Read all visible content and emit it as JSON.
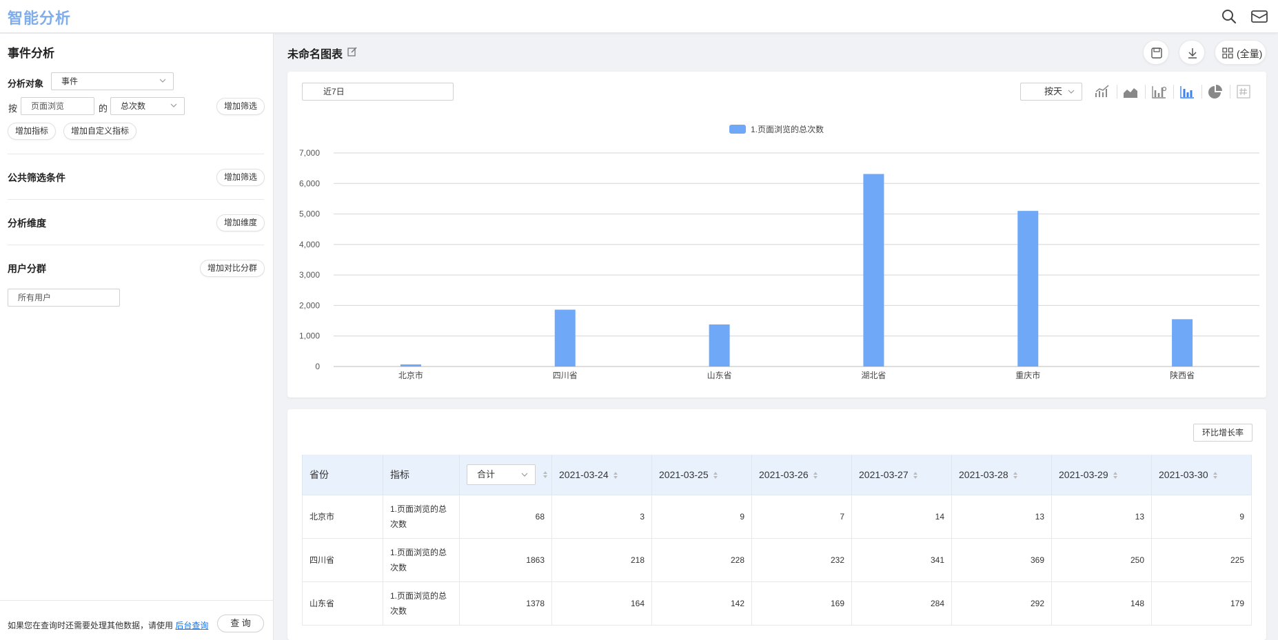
{
  "app": {
    "brand": "智能分析"
  },
  "header": {
    "icons": [
      "search-icon",
      "mail-icon"
    ]
  },
  "left": {
    "title": "事件分析",
    "analysis_target_label": "分析对象",
    "analysis_target_value": "事件",
    "by_label": "按",
    "event_value": "页面浏览",
    "of_label": "的",
    "metric_value": "总次数",
    "add_filter": "增加筛选",
    "add_metric": "增加指标",
    "add_custom_metric": "增加自定义指标",
    "public_filter_title": "公共筛选条件",
    "public_add_filter": "增加筛选",
    "dimension_title": "分析维度",
    "add_dimension": "增加维度",
    "segment_title": "用户分群",
    "add_segment": "增加对比分群",
    "segment_value": "所有用户",
    "footer_note": "如果您在查询时还需要处理其他数据，请使用",
    "footer_link": "后台查询",
    "query_button": "查 询"
  },
  "main": {
    "chart_title": "未命名图表",
    "fullscreen_label": "(全量)",
    "date_range": "近7日",
    "granularity": "按天",
    "ratio_button": "环比增长率"
  },
  "colors": {
    "bar": "#6fa8f7",
    "accent": "#1a73e8",
    "brand": "#7fadea"
  },
  "chart_data": {
    "type": "bar",
    "categories": [
      "北京市",
      "四川省",
      "山东省",
      "湖北省",
      "重庆市",
      "陕西省"
    ],
    "series": [
      {
        "name": "1.页面浏览的总次数",
        "values": [
          68,
          1863,
          1378,
          6310,
          5100,
          1550
        ]
      }
    ],
    "ylim": [
      0,
      7000
    ],
    "yticks": [
      "0",
      "1,000",
      "2,000",
      "3,000",
      "4,000",
      "5,000",
      "6,000",
      "7,000"
    ],
    "grid": true,
    "legend": "top-center"
  },
  "table": {
    "headers": {
      "province": "省份",
      "metric": "指标",
      "total": "合计"
    },
    "dates": [
      "2021-03-24",
      "2021-03-25",
      "2021-03-26",
      "2021-03-27",
      "2021-03-28",
      "2021-03-29",
      "2021-03-30"
    ],
    "rows": [
      {
        "province": "北京市",
        "metric": "1.页面浏览的总次数",
        "total": "68",
        "values": [
          "3",
          "9",
          "7",
          "14",
          "13",
          "13",
          "9"
        ]
      },
      {
        "province": "四川省",
        "metric": "1.页面浏览的总次数",
        "total": "1863",
        "values": [
          "218",
          "228",
          "232",
          "341",
          "369",
          "250",
          "225"
        ]
      },
      {
        "province": "山东省",
        "metric": "1.页面浏览的总次数",
        "total": "1378",
        "values": [
          "164",
          "142",
          "169",
          "284",
          "292",
          "148",
          "179"
        ]
      }
    ]
  }
}
